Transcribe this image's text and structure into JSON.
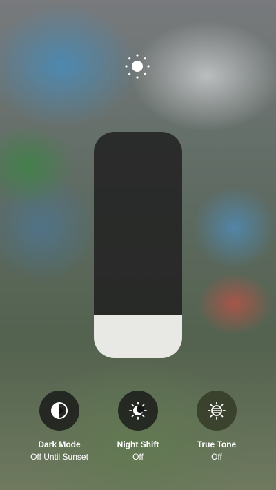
{
  "brightness": {
    "icon": "sun-icon",
    "level": 0.19
  },
  "controls": [
    {
      "icon": "dark-mode-icon",
      "label": "Dark Mode",
      "status": "Off Until Sunset"
    },
    {
      "icon": "night-shift-icon",
      "label": "Night Shift",
      "status": "Off"
    },
    {
      "icon": "true-tone-icon",
      "label": "True Tone",
      "status": "Off"
    }
  ],
  "colors": {
    "slider_track": "#222222",
    "slider_fill": "#e8e9e5",
    "icon_tint": "#ffffff"
  }
}
